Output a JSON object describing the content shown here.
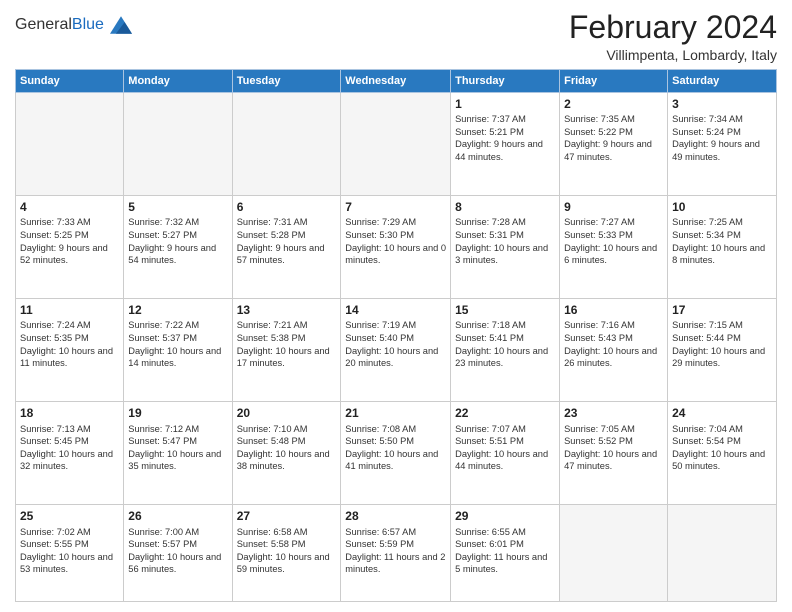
{
  "header": {
    "logo": {
      "general": "General",
      "blue": "Blue"
    },
    "month": "February 2024",
    "location": "Villimpenta, Lombardy, Italy"
  },
  "weekdays": [
    "Sunday",
    "Monday",
    "Tuesday",
    "Wednesday",
    "Thursday",
    "Friday",
    "Saturday"
  ],
  "weeks": [
    [
      {
        "day": "",
        "empty": true
      },
      {
        "day": "",
        "empty": true
      },
      {
        "day": "",
        "empty": true
      },
      {
        "day": "",
        "empty": true
      },
      {
        "day": "1",
        "sunrise": "7:37 AM",
        "sunset": "5:21 PM",
        "daylight": "9 hours and 44 minutes."
      },
      {
        "day": "2",
        "sunrise": "7:35 AM",
        "sunset": "5:22 PM",
        "daylight": "9 hours and 47 minutes."
      },
      {
        "day": "3",
        "sunrise": "7:34 AM",
        "sunset": "5:24 PM",
        "daylight": "9 hours and 49 minutes."
      }
    ],
    [
      {
        "day": "4",
        "sunrise": "7:33 AM",
        "sunset": "5:25 PM",
        "daylight": "9 hours and 52 minutes."
      },
      {
        "day": "5",
        "sunrise": "7:32 AM",
        "sunset": "5:27 PM",
        "daylight": "9 hours and 54 minutes."
      },
      {
        "day": "6",
        "sunrise": "7:31 AM",
        "sunset": "5:28 PM",
        "daylight": "9 hours and 57 minutes."
      },
      {
        "day": "7",
        "sunrise": "7:29 AM",
        "sunset": "5:30 PM",
        "daylight": "10 hours and 0 minutes."
      },
      {
        "day": "8",
        "sunrise": "7:28 AM",
        "sunset": "5:31 PM",
        "daylight": "10 hours and 3 minutes."
      },
      {
        "day": "9",
        "sunrise": "7:27 AM",
        "sunset": "5:33 PM",
        "daylight": "10 hours and 6 minutes."
      },
      {
        "day": "10",
        "sunrise": "7:25 AM",
        "sunset": "5:34 PM",
        "daylight": "10 hours and 8 minutes."
      }
    ],
    [
      {
        "day": "11",
        "sunrise": "7:24 AM",
        "sunset": "5:35 PM",
        "daylight": "10 hours and 11 minutes."
      },
      {
        "day": "12",
        "sunrise": "7:22 AM",
        "sunset": "5:37 PM",
        "daylight": "10 hours and 14 minutes."
      },
      {
        "day": "13",
        "sunrise": "7:21 AM",
        "sunset": "5:38 PM",
        "daylight": "10 hours and 17 minutes."
      },
      {
        "day": "14",
        "sunrise": "7:19 AM",
        "sunset": "5:40 PM",
        "daylight": "10 hours and 20 minutes."
      },
      {
        "day": "15",
        "sunrise": "7:18 AM",
        "sunset": "5:41 PM",
        "daylight": "10 hours and 23 minutes."
      },
      {
        "day": "16",
        "sunrise": "7:16 AM",
        "sunset": "5:43 PM",
        "daylight": "10 hours and 26 minutes."
      },
      {
        "day": "17",
        "sunrise": "7:15 AM",
        "sunset": "5:44 PM",
        "daylight": "10 hours and 29 minutes."
      }
    ],
    [
      {
        "day": "18",
        "sunrise": "7:13 AM",
        "sunset": "5:45 PM",
        "daylight": "10 hours and 32 minutes."
      },
      {
        "day": "19",
        "sunrise": "7:12 AM",
        "sunset": "5:47 PM",
        "daylight": "10 hours and 35 minutes."
      },
      {
        "day": "20",
        "sunrise": "7:10 AM",
        "sunset": "5:48 PM",
        "daylight": "10 hours and 38 minutes."
      },
      {
        "day": "21",
        "sunrise": "7:08 AM",
        "sunset": "5:50 PM",
        "daylight": "10 hours and 41 minutes."
      },
      {
        "day": "22",
        "sunrise": "7:07 AM",
        "sunset": "5:51 PM",
        "daylight": "10 hours and 44 minutes."
      },
      {
        "day": "23",
        "sunrise": "7:05 AM",
        "sunset": "5:52 PM",
        "daylight": "10 hours and 47 minutes."
      },
      {
        "day": "24",
        "sunrise": "7:04 AM",
        "sunset": "5:54 PM",
        "daylight": "10 hours and 50 minutes."
      }
    ],
    [
      {
        "day": "25",
        "sunrise": "7:02 AM",
        "sunset": "5:55 PM",
        "daylight": "10 hours and 53 minutes."
      },
      {
        "day": "26",
        "sunrise": "7:00 AM",
        "sunset": "5:57 PM",
        "daylight": "10 hours and 56 minutes."
      },
      {
        "day": "27",
        "sunrise": "6:58 AM",
        "sunset": "5:58 PM",
        "daylight": "10 hours and 59 minutes."
      },
      {
        "day": "28",
        "sunrise": "6:57 AM",
        "sunset": "5:59 PM",
        "daylight": "11 hours and 2 minutes."
      },
      {
        "day": "29",
        "sunrise": "6:55 AM",
        "sunset": "6:01 PM",
        "daylight": "11 hours and 5 minutes."
      },
      {
        "day": "",
        "empty": true
      },
      {
        "day": "",
        "empty": true
      }
    ]
  ]
}
